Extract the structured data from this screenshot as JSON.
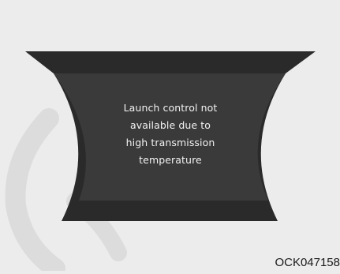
{
  "display": {
    "message_lines": [
      "Launch control not",
      "available due to",
      "high transmission",
      "temperature"
    ]
  },
  "figure": {
    "reference_code": "OCK047158"
  },
  "colors": {
    "background": "#ececec",
    "panel_outer": "#2a2a2a",
    "panel_inner": "#3a3a3a",
    "text": "#f2f2f2",
    "watermark": "#dcdcdc"
  }
}
